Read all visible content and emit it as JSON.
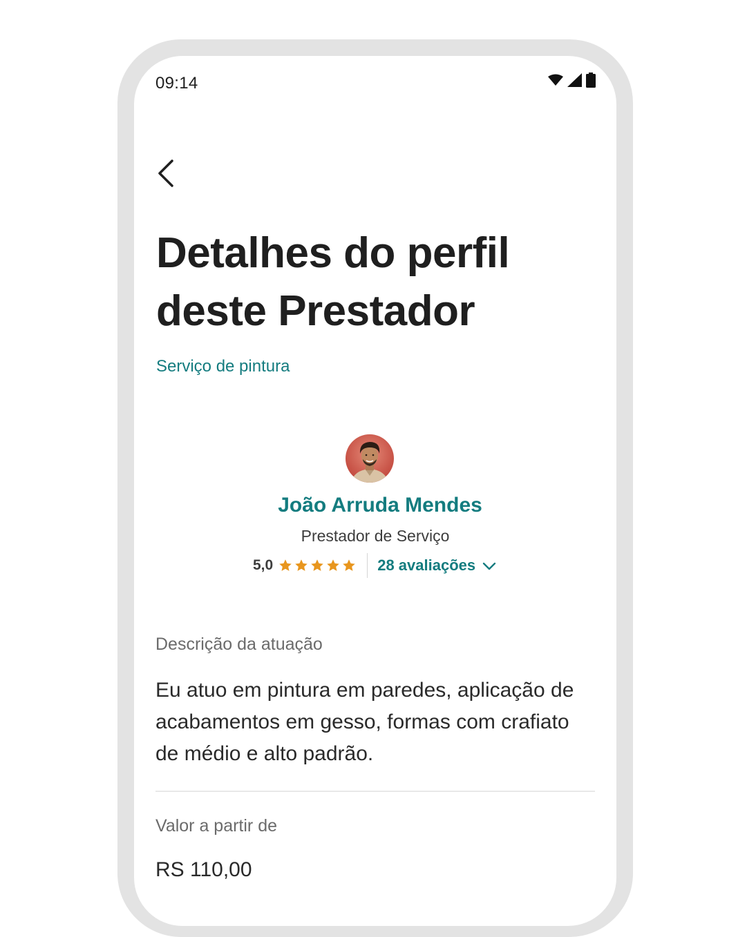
{
  "status_bar": {
    "time": "09:14",
    "icons": [
      "wifi-icon",
      "signal-icon",
      "battery-icon"
    ]
  },
  "header": {
    "back_icon": "chevron-left-icon",
    "title": "Detalhes do perfil deste Prestador"
  },
  "category": "Serviço de pintura",
  "provider": {
    "name": "João Arruda Mendes",
    "role": "Prestador de Serviço",
    "rating_value": "5,0",
    "stars": 5,
    "reviews_label": "28 avaliações",
    "reviews_icon": "chevron-down-icon"
  },
  "description": {
    "label": "Descrição da atuação",
    "text": "Eu atuo em pintura em paredes, aplicação de acabamentos em gesso, formas com crafiato de médio e alto padrão."
  },
  "price": {
    "label": "Valor a partir de",
    "value": "RS 110,00"
  },
  "colors": {
    "accent": "#147c7f",
    "star": "#e8961e",
    "frame": "#e3e3e3"
  }
}
